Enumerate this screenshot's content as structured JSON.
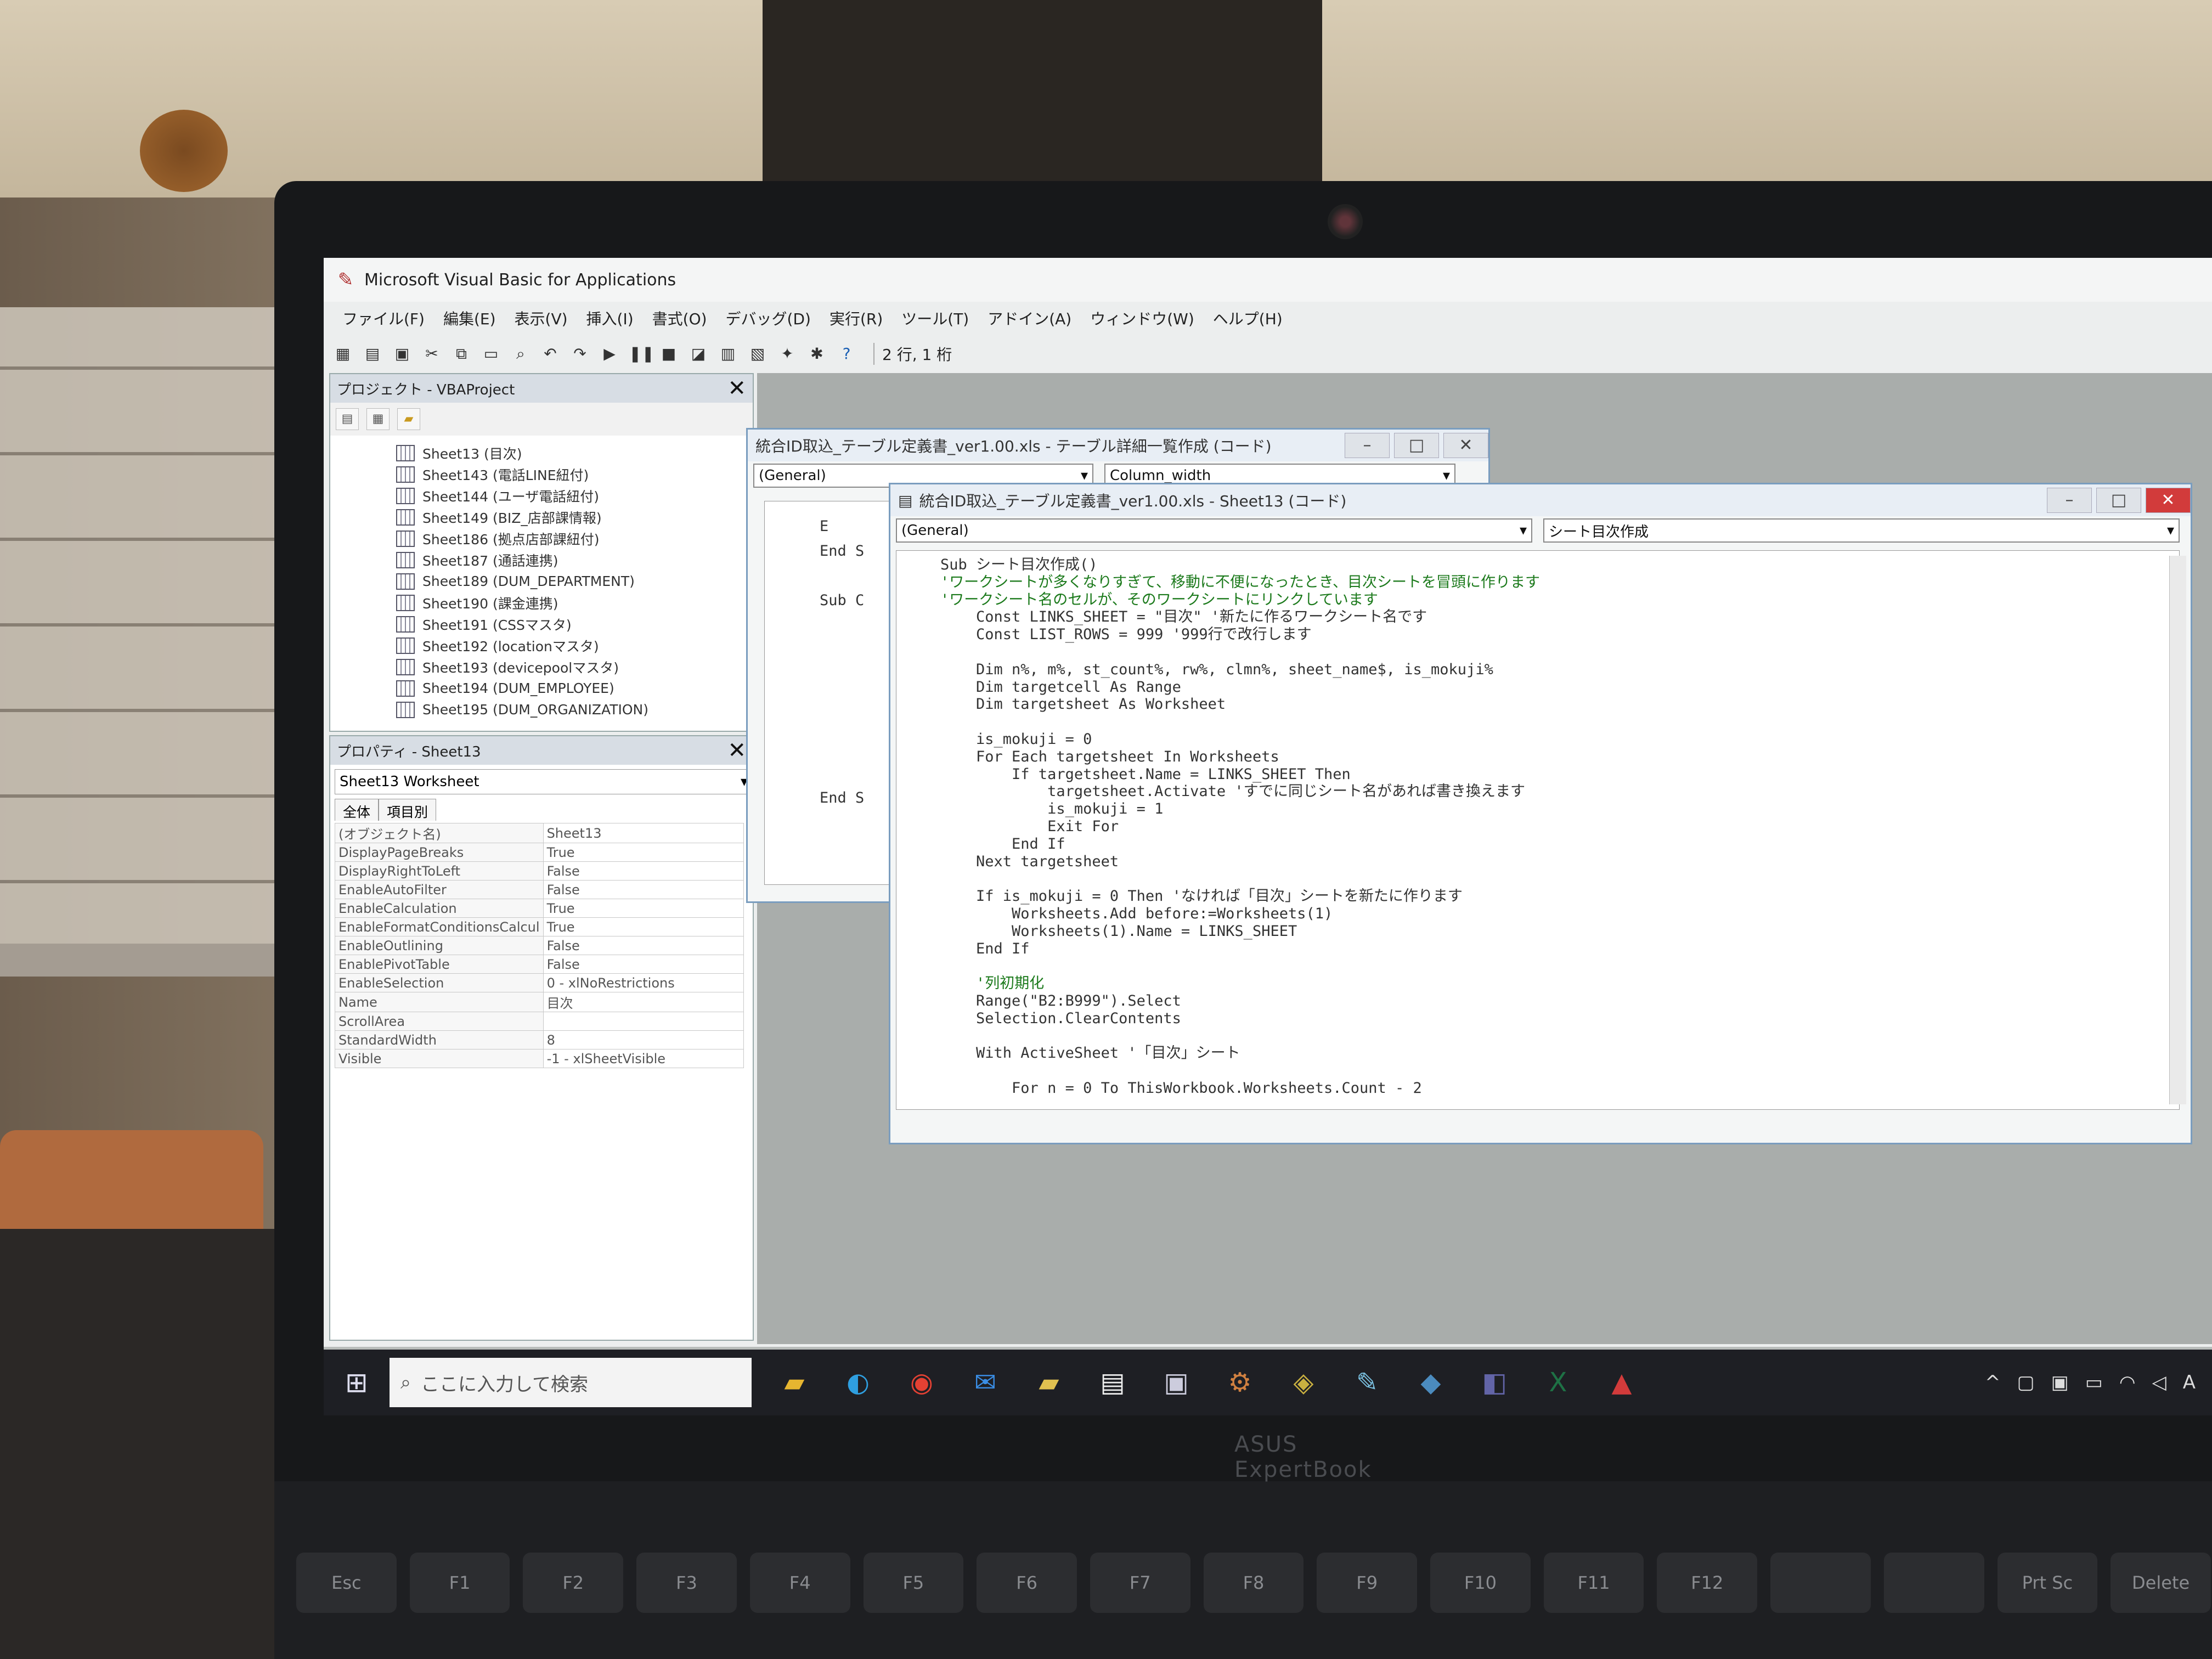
{
  "app": {
    "title": "Microsoft Visual Basic for Applications",
    "menu": [
      "ファイル(F)",
      "編集(E)",
      "表示(V)",
      "挿入(I)",
      "書式(O)",
      "デバッグ(D)",
      "実行(R)",
      "ツール(T)",
      "アドイン(A)",
      "ウィンドウ(W)",
      "ヘルプ(H)"
    ],
    "cursor_position": "2 行, 1 桁"
  },
  "project": {
    "title": "プロジェクト - VBAProject",
    "items": [
      "Sheet13 (目次)",
      "Sheet143 (電話LINE紐付)",
      "Sheet144 (ユーザ電話紐付)",
      "Sheet149 (BIZ_店部課情報)",
      "Sheet186 (拠点店部課紐付)",
      "Sheet187 (通話連携)",
      "Sheet189 (DUM_DEPARTMENT)",
      "Sheet190 (課金連携)",
      "Sheet191 (CSSマスタ)",
      "Sheet192 (locationマスタ)",
      "Sheet193 (devicepoolマスタ)",
      "Sheet194 (DUM_EMPLOYEE)",
      "Sheet195 (DUM_ORGANIZATION)"
    ]
  },
  "properties": {
    "title": "プロパティ - Sheet13",
    "object": "Sheet13 Worksheet",
    "tabs": [
      "全体",
      "項目別"
    ],
    "rows": [
      {
        "name": "(オブジェクト名)",
        "value": "Sheet13"
      },
      {
        "name": "DisplayPageBreaks",
        "value": "True"
      },
      {
        "name": "DisplayRightToLeft",
        "value": "False"
      },
      {
        "name": "EnableAutoFilter",
        "value": "False"
      },
      {
        "name": "EnableCalculation",
        "value": "True"
      },
      {
        "name": "EnableFormatConditionsCalcul",
        "value": "True"
      },
      {
        "name": "EnableOutlining",
        "value": "False"
      },
      {
        "name": "EnablePivotTable",
        "value": "False"
      },
      {
        "name": "EnableSelection",
        "value": "0 - xlNoRestrictions"
      },
      {
        "name": "Name",
        "value": "目次"
      },
      {
        "name": "ScrollArea",
        "value": ""
      },
      {
        "name": "StandardWidth",
        "value": "8"
      },
      {
        "name": "Visible",
        "value": "-1 - xlSheetVisible"
      }
    ]
  },
  "back_window": {
    "title": "統合ID取込_テーブル定義書_ver1.00.xls - テーブル詳細一覧作成 (コード)",
    "combo_left": "(General)",
    "combo_right": "Column_width",
    "lines": [
      "E",
      "End S",
      "",
      "Sub C",
      "",
      "",
      "",
      "",
      "",
      "",
      "",
      "End S"
    ]
  },
  "front_window": {
    "title": "統合ID取込_テーブル定義書_ver1.00.xls - Sheet13 (コード)",
    "combo_left": "(General)",
    "combo_right": "シート目次作成",
    "code": [
      "Sub シート目次作成()",
      "'ワークシートが多くなりすぎて、移動に不便になったとき、目次シートを冒頭に作ります",
      "'ワークシート名のセルが、そのワークシートにリンクしています",
      "    Const LINKS_SHEET = \"目次\" '新たに作るワークシート名です",
      "    Const LIST_ROWS = 999 '999行で改行します",
      "",
      "    Dim n%, m%, st_count%, rw%, clmn%, sheet_name$, is_mokuji%",
      "    Dim targetcell As Range",
      "    Dim targetsheet As Worksheet",
      "",
      "    is_mokuji = 0",
      "    For Each targetsheet In Worksheets",
      "        If targetsheet.Name = LINKS_SHEET Then",
      "            targetsheet.Activate 'すでに同じシート名があれば書き換えます",
      "            is_mokuji = 1",
      "            Exit For",
      "        End If",
      "    Next targetsheet",
      "",
      "    If is_mokuji = 0 Then 'なければ「目次」シートを新たに作ります",
      "        Worksheets.Add before:=Worksheets(1)",
      "        Worksheets(1).Name = LINKS_SHEET",
      "    End If",
      "",
      "    '列初期化",
      "    Range(\"B2:B999\").Select",
      "    Selection.ClearContents",
      "",
      "    With ActiveSheet '「目次」シート",
      "",
      "        For n = 0 To ThisWorkbook.Worksheets.Count - 2"
    ]
  },
  "taskbar": {
    "search_placeholder": "ここに入力して検索",
    "apps": [
      "file-explorer",
      "edge",
      "chrome",
      "mail",
      "folder",
      "notepad",
      "photos",
      "settings",
      "map",
      "edit",
      "python",
      "teams",
      "excel",
      "acrobat"
    ]
  },
  "device": {
    "brand": "ASUS ExpertBook",
    "fn_keys": [
      "Esc",
      "F1",
      "F2",
      "F3",
      "F4",
      "F5",
      "F6",
      "F7",
      "F8",
      "F9",
      "F10",
      "F11",
      "F12",
      "",
      "",
      "Prt Sc",
      "Delete"
    ]
  }
}
